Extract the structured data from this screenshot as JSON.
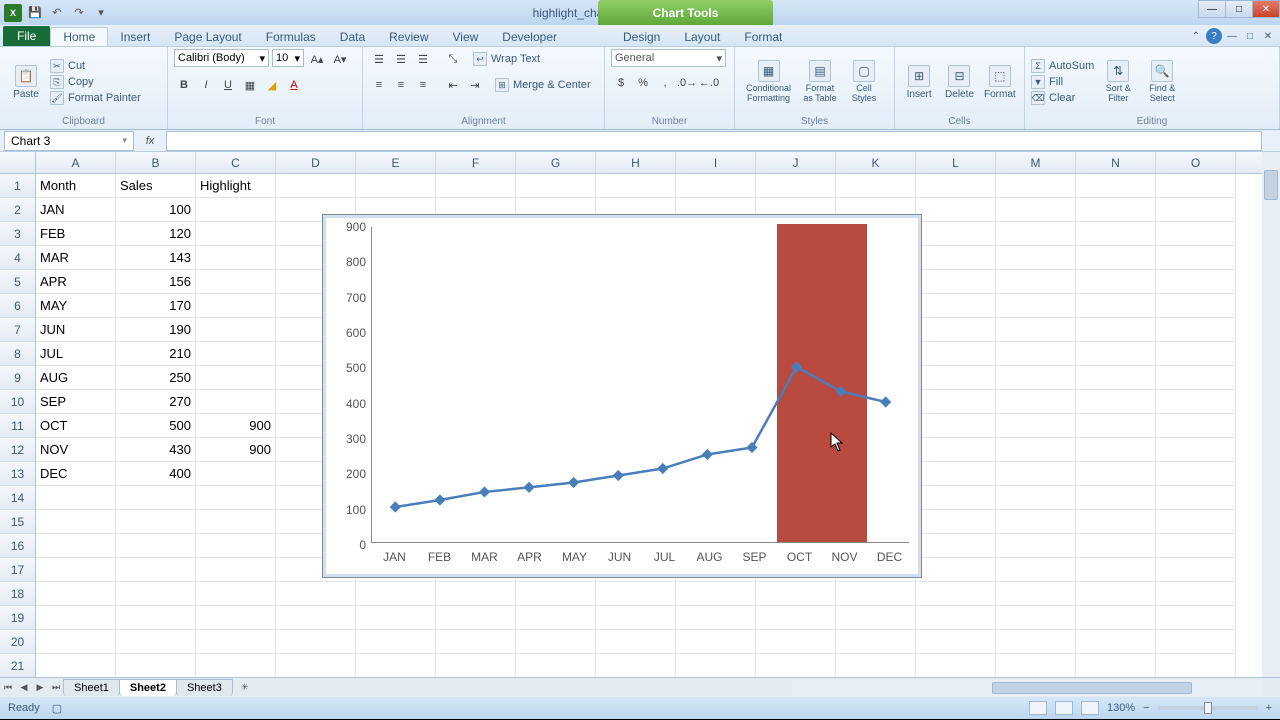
{
  "title": "highlight_chart_section - Microsoft Excel",
  "chart_tools_label": "Chart Tools",
  "tabs": {
    "file": "File",
    "home": "Home",
    "insert": "Insert",
    "page_layout": "Page Layout",
    "formulas": "Formulas",
    "data": "Data",
    "review": "Review",
    "view": "View",
    "developer": "Developer",
    "design": "Design",
    "layout": "Layout",
    "format": "Format"
  },
  "ribbon": {
    "clipboard": {
      "label": "Clipboard",
      "paste": "Paste",
      "cut": "Cut",
      "copy": "Copy",
      "format_painter": "Format Painter"
    },
    "font": {
      "label": "Font",
      "family": "Calibri (Body)",
      "size": "10"
    },
    "alignment": {
      "label": "Alignment",
      "wrap": "Wrap Text",
      "merge": "Merge & Center"
    },
    "number": {
      "label": "Number",
      "format": "General"
    },
    "styles": {
      "label": "Styles",
      "cond": "Conditional Formatting",
      "table": "Format as Table",
      "cell": "Cell Styles"
    },
    "cells": {
      "label": "Cells",
      "insert": "Insert",
      "delete": "Delete",
      "format": "Format"
    },
    "editing": {
      "label": "Editing",
      "autosum": "AutoSum",
      "fill": "Fill",
      "clear": "Clear",
      "sort": "Sort & Filter",
      "find": "Find & Select"
    }
  },
  "namebox": "Chart 3",
  "columns": [
    "A",
    "B",
    "C",
    "D",
    "E",
    "F",
    "G",
    "H",
    "I",
    "J",
    "K",
    "L",
    "M",
    "N",
    "O"
  ],
  "data_rows": [
    {
      "n": "1",
      "a": "Month",
      "b": "Sales",
      "c": "Highlight"
    },
    {
      "n": "2",
      "a": "JAN",
      "b": "100",
      "c": ""
    },
    {
      "n": "3",
      "a": "FEB",
      "b": "120",
      "c": ""
    },
    {
      "n": "4",
      "a": "MAR",
      "b": "143",
      "c": ""
    },
    {
      "n": "5",
      "a": "APR",
      "b": "156",
      "c": ""
    },
    {
      "n": "6",
      "a": "MAY",
      "b": "170",
      "c": ""
    },
    {
      "n": "7",
      "a": "JUN",
      "b": "190",
      "c": ""
    },
    {
      "n": "8",
      "a": "JUL",
      "b": "210",
      "c": ""
    },
    {
      "n": "9",
      "a": "AUG",
      "b": "250",
      "c": ""
    },
    {
      "n": "10",
      "a": "SEP",
      "b": "270",
      "c": ""
    },
    {
      "n": "11",
      "a": "OCT",
      "b": "500",
      "c": "900"
    },
    {
      "n": "12",
      "a": "NOV",
      "b": "430",
      "c": "900"
    },
    {
      "n": "13",
      "a": "DEC",
      "b": "400",
      "c": ""
    }
  ],
  "blank_rows": [
    "14",
    "15",
    "16",
    "17",
    "18",
    "19",
    "20",
    "21"
  ],
  "sheets": {
    "s1": "Sheet1",
    "s2": "Sheet2",
    "s3": "Sheet3"
  },
  "status": {
    "ready": "Ready",
    "zoom": "130%"
  },
  "chart_data": {
    "type": "line+bar",
    "categories": [
      "JAN",
      "FEB",
      "MAR",
      "APR",
      "MAY",
      "JUN",
      "JUL",
      "AUG",
      "SEP",
      "OCT",
      "NOV",
      "DEC"
    ],
    "series": [
      {
        "name": "Sales",
        "type": "line",
        "values": [
          100,
          120,
          143,
          156,
          170,
          190,
          210,
          250,
          270,
          500,
          430,
          400
        ]
      },
      {
        "name": "Highlight",
        "type": "bar",
        "values": [
          null,
          null,
          null,
          null,
          null,
          null,
          null,
          null,
          null,
          900,
          900,
          null
        ]
      }
    ],
    "ylim": [
      0,
      900
    ],
    "yticks": [
      0,
      100,
      200,
      300,
      400,
      500,
      600,
      700,
      800,
      900
    ],
    "title": "",
    "xlabel": "",
    "ylabel": ""
  }
}
